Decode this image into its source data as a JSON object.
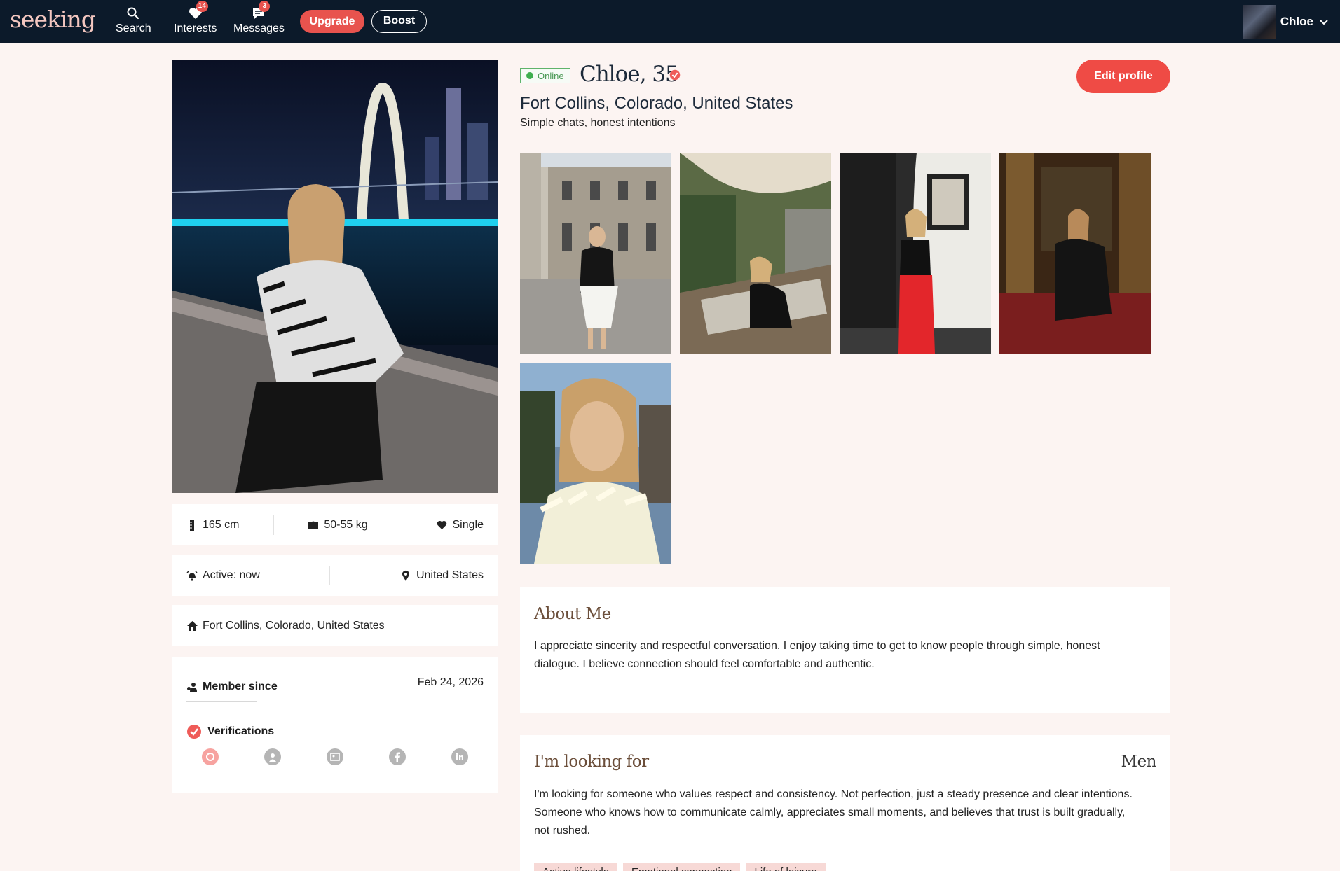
{
  "nav": {
    "logo": "seeking",
    "items": [
      {
        "label": "Search",
        "icon": "search-icon"
      },
      {
        "label": "Interests",
        "icon": "heart-icon",
        "badge": "14"
      },
      {
        "label": "Messages",
        "icon": "chat-icon",
        "badge": "3"
      }
    ],
    "upgrade_label": "Upgrade",
    "boost_label": "Boost",
    "user_name": "Chloe"
  },
  "profile": {
    "status": "Online",
    "name_age": "Chloe, 35",
    "location": "Fort Collins, Colorado, United States",
    "tagline": "Simple chats, honest intentions",
    "edit_label": "Edit profile"
  },
  "stats": {
    "height": "165 cm",
    "weight": "50-55 kg",
    "relationship": "Single",
    "active": "Active: now",
    "country": "United States",
    "city": "Fort Collins, Colorado, United States",
    "member_since_label": "Member since",
    "member_since_date": "Feb 24, 2026",
    "verifications_label": "Verifications"
  },
  "about": {
    "title": "About Me",
    "text": "I appreciate sincerity and respectful conversation. I enjoy taking time to get to know people through simple, honest dialogue. I believe connection should feel comfortable and authentic."
  },
  "looking": {
    "title": "I'm looking for",
    "gender": "Men",
    "text": "I'm looking for someone who values respect and consistency. Not perfection, just a steady presence and clear intentions. Someone who knows how to communicate calmly, appreciates small moments, and believes that trust is built gradually, not rushed.",
    "tags": [
      "Active lifestyle",
      "Emotional connection",
      "Life of leisure"
    ]
  },
  "colors": {
    "nav_bg": "#0c1a2a",
    "accent": "#ef4b45",
    "page_bg": "#fcf4f2",
    "online_green": "#3fae4f"
  }
}
